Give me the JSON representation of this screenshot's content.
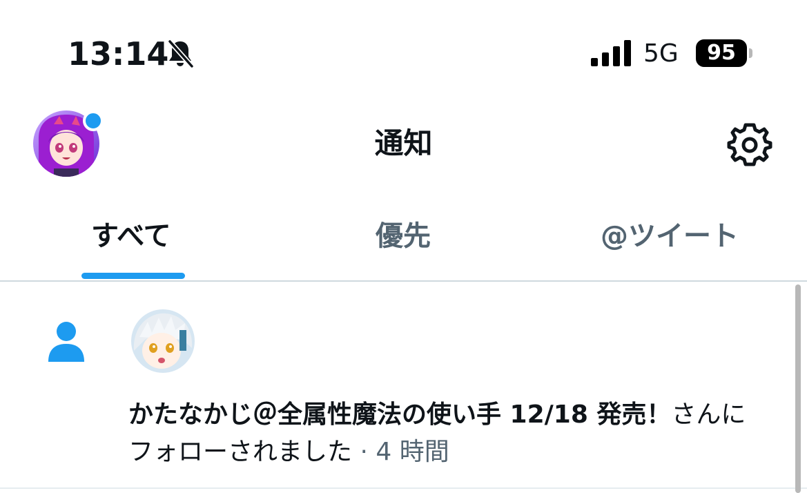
{
  "status_bar": {
    "time": "13:14",
    "silent_icon": "bell-slash-icon",
    "signal_icon": "cellular-signal-icon",
    "network": "5G",
    "battery": "95"
  },
  "header": {
    "title": "通知",
    "avatar": "profile-avatar",
    "settings_icon": "gear-icon"
  },
  "tabs": [
    {
      "label": "すべて",
      "active": true
    },
    {
      "label": "優先",
      "active": false
    },
    {
      "label": "@ツイート",
      "active": false
    }
  ],
  "notification": {
    "type_icon": "person-icon",
    "user_name": "かたなかじ＠全属性魔法の使い手 12/18 発売！",
    "message": "さんにフォローされました",
    "separator": " · ",
    "time_ago": "4 時間"
  },
  "colors": {
    "accent": "#1d9bf0",
    "text_primary": "#0f1419",
    "text_secondary": "#536471"
  }
}
